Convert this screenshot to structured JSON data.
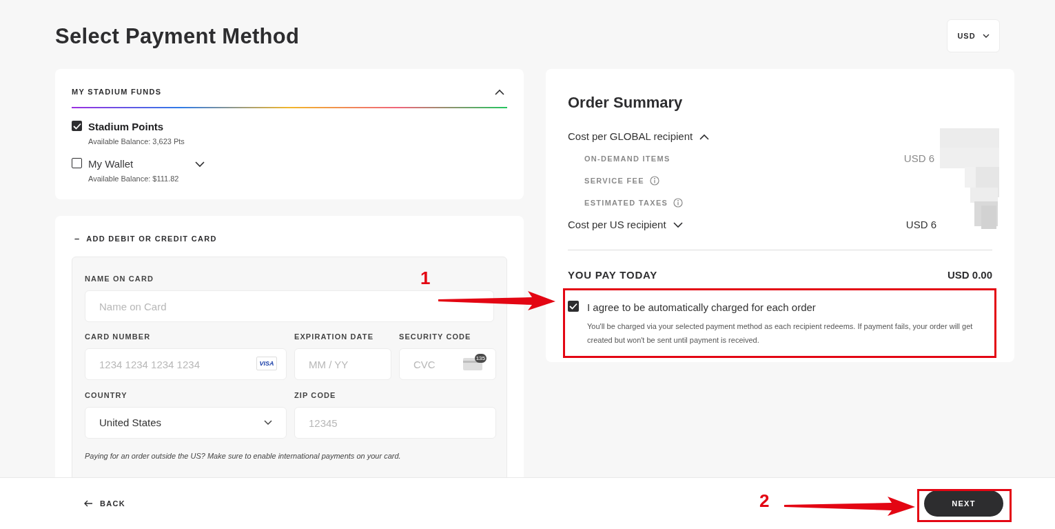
{
  "page": {
    "title": "Select Payment Method"
  },
  "currency": {
    "label": "USD"
  },
  "funds": {
    "title": "MY STADIUM FUNDS",
    "expanded": true,
    "options": [
      {
        "label": "Stadium Points",
        "balance": "Available Balance: 3,623 Pts",
        "checked": true,
        "kind": "plain"
      },
      {
        "label": "My Wallet",
        "balance": "Available Balance: $111.82",
        "checked": false,
        "kind": "expandable"
      }
    ]
  },
  "card_form": {
    "title": "ADD DEBIT OR CREDIT CARD",
    "toggle": "–",
    "name": {
      "label": "NAME ON CARD",
      "placeholder": "Name on Card"
    },
    "number": {
      "label": "CARD NUMBER",
      "placeholder": "1234 1234 1234 1234",
      "brand": "VISA"
    },
    "expiry": {
      "label": "EXPIRATION DATE",
      "placeholder": "MM / YY"
    },
    "cvc": {
      "label": "SECURITY CODE",
      "placeholder": "CVC",
      "badge": "135"
    },
    "country": {
      "label": "COUNTRY",
      "value": "United States"
    },
    "zip": {
      "label": "ZIP CODE",
      "placeholder": "12345"
    },
    "note": "Paying for an order outside the US? Make sure to enable international payments on your card."
  },
  "summary": {
    "title": "Order Summary",
    "redacted": true,
    "groups": [
      {
        "label": "Cost per GLOBAL recipient",
        "expanded": true,
        "items": [
          {
            "label": "ON-DEMAND ITEMS",
            "info": false,
            "amount": "USD 6"
          },
          {
            "label": "SERVICE FEE",
            "info": true
          },
          {
            "label": "ESTIMATED TAXES",
            "info": true
          }
        ]
      },
      {
        "label": "Cost per US recipient",
        "expanded": false,
        "amount": "USD 6"
      }
    ],
    "total": {
      "label": "YOU PAY TODAY",
      "amount": "USD 0.00"
    },
    "agree": {
      "checked": true,
      "label": "I agree to be automatically charged for each order",
      "note": "You'll be charged via your selected payment method as each recipient redeems. If payment fails, your order will get created but won't be sent until payment is received."
    }
  },
  "footer": {
    "back": "BACK",
    "next": "NEXT"
  },
  "annotations": [
    {
      "number": "1"
    },
    {
      "number": "2"
    }
  ]
}
